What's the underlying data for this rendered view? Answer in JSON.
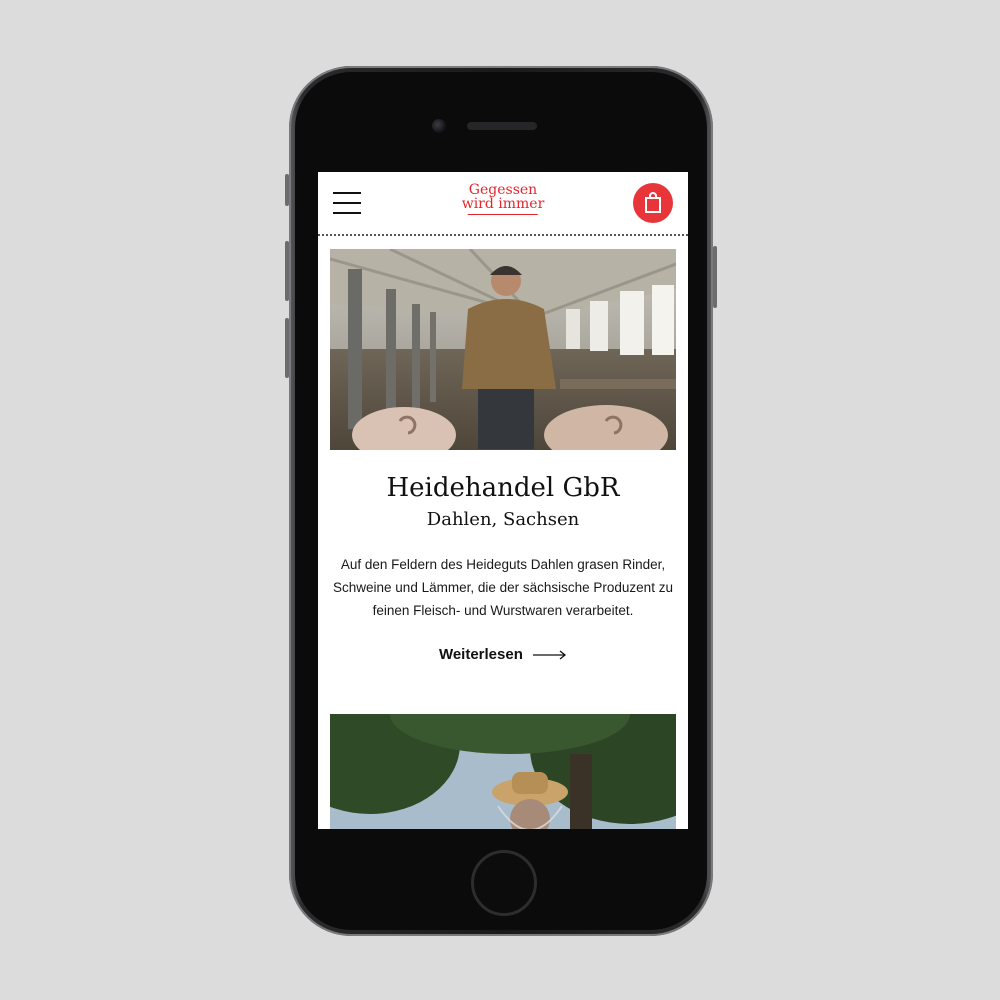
{
  "header": {
    "logo_line1": "Gegessen",
    "logo_line2": "wird immer",
    "menu_icon": "hamburger-icon",
    "cart_icon": "shopping-bag-icon"
  },
  "producer": {
    "name": "Heidehandel GbR",
    "location": "Dahlen, Sachsen",
    "description": "Auf den Feldern des Heideguts Dahlen grasen Rinder, Schweine und Lämmer, die der sächsische Produzent zu feinen Fleisch- und Wurstwaren verarbeitet.",
    "read_more": "Weiterlesen"
  },
  "colors": {
    "brand_red": "#e3262d",
    "background": "#dcdcdc",
    "text": "#111111"
  }
}
